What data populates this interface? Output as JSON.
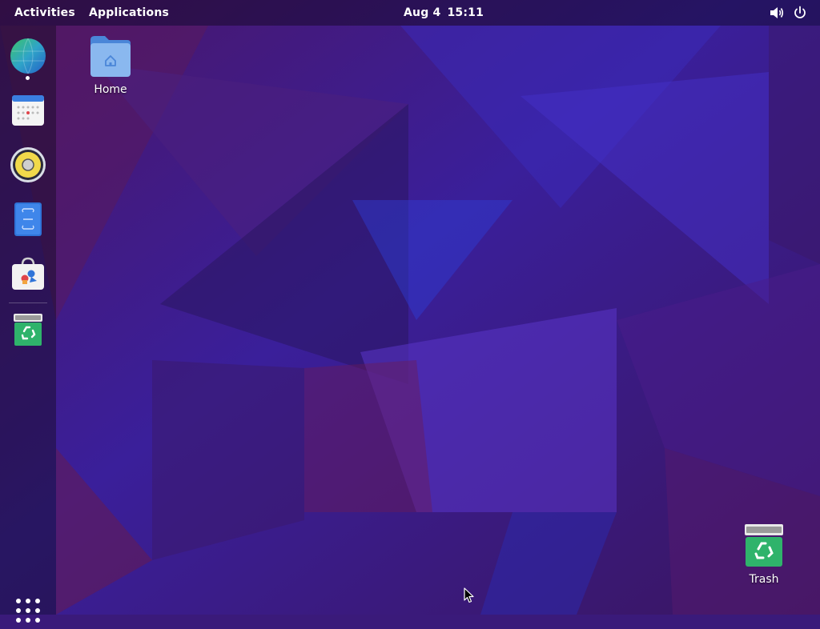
{
  "topbar": {
    "activities_label": "Activities",
    "applications_label": "Applications",
    "clock_date": "Aug 4",
    "clock_time": "15:11"
  },
  "dash": {
    "items": [
      {
        "name": "Web Browser",
        "icon": "globe-icon",
        "running": true
      },
      {
        "name": "Calendar",
        "icon": "calendar-icon",
        "running": false
      },
      {
        "name": "Rhythmbox",
        "icon": "speaker-icon",
        "running": false
      },
      {
        "name": "Document Viewer",
        "icon": "document-icon",
        "running": false
      },
      {
        "name": "Software",
        "icon": "shopping-bag-icon",
        "running": false
      },
      {
        "name": "Trash",
        "icon": "recycle-bin-icon",
        "running": false
      }
    ],
    "show_apps_icon": "app-grid-icon"
  },
  "desktop": {
    "icons": [
      {
        "label": "Home",
        "icon": "home-folder-icon"
      },
      {
        "label": "Trash",
        "icon": "recycle-bin-icon"
      }
    ]
  },
  "colors": {
    "wallpaper_base": "#3a1a7a",
    "wallpaper_blue": "#3a2bd0",
    "wallpaper_red": "#7a1a4a",
    "trash_green": "#2fb36b",
    "folder_blue": "#8ab8ef"
  }
}
